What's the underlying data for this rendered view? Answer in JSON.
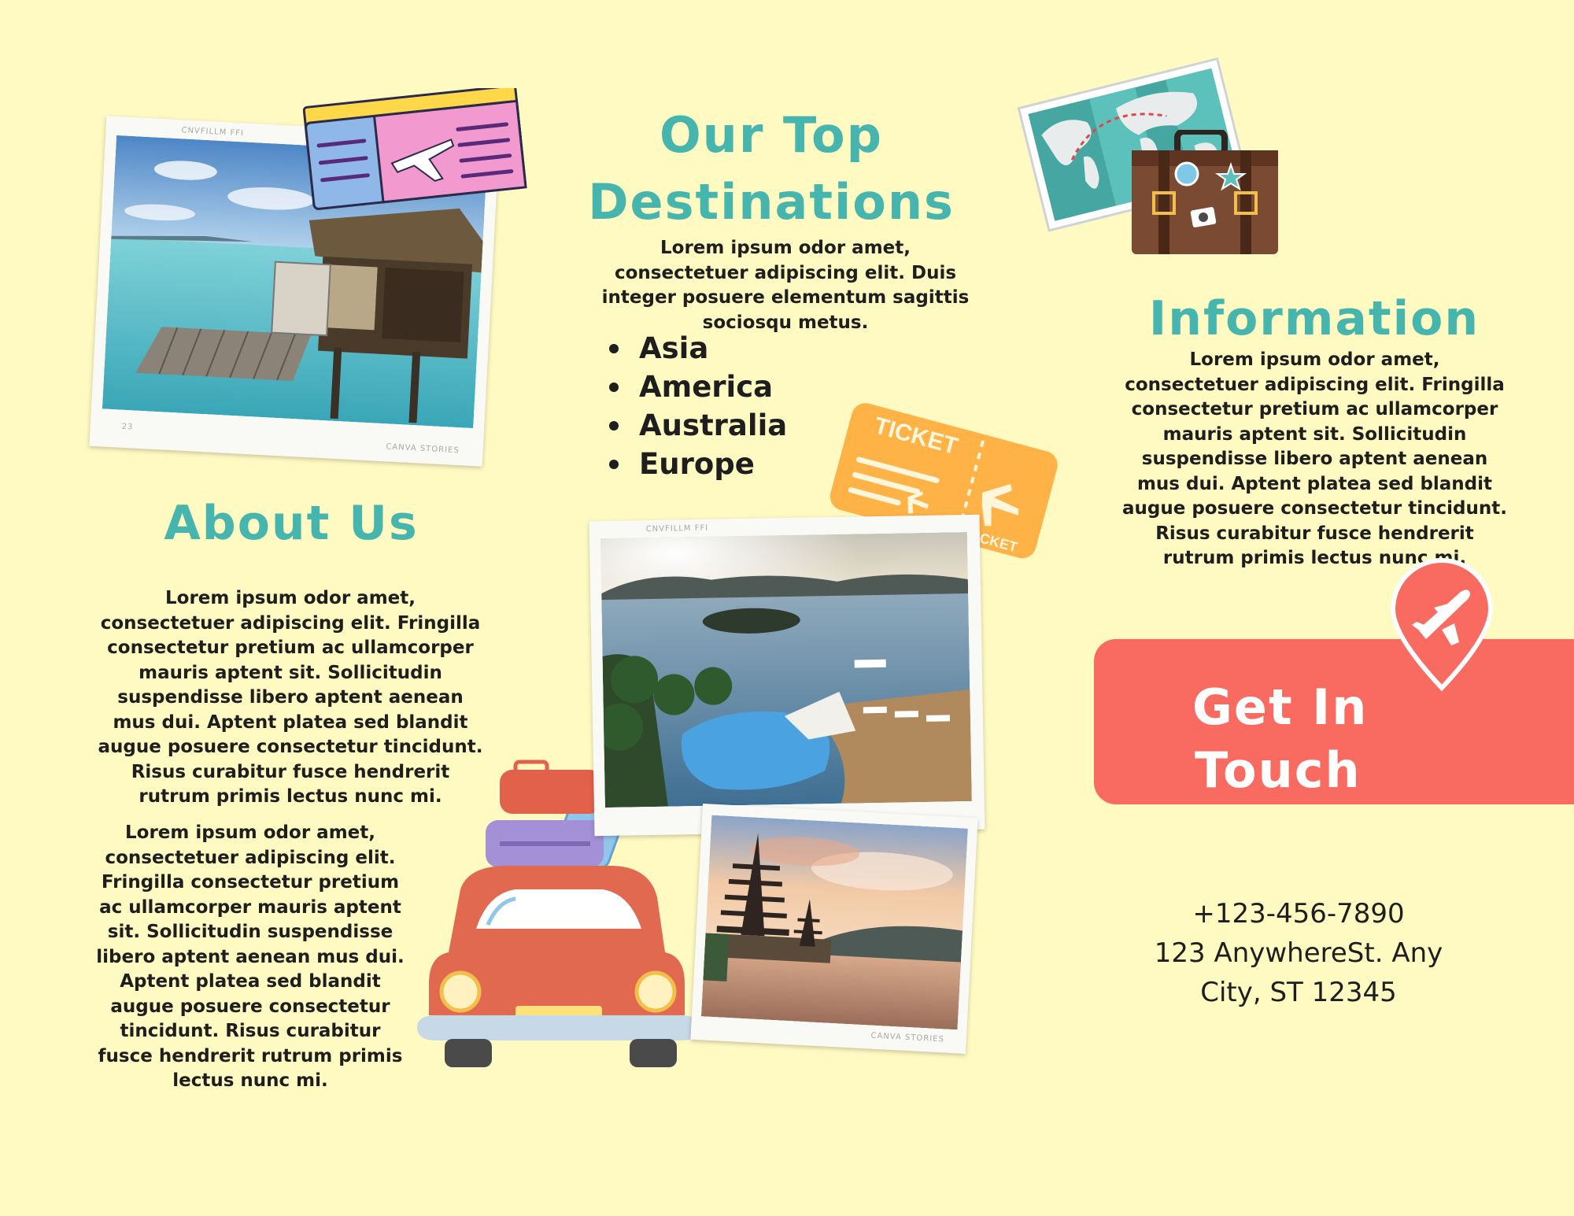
{
  "destinations": {
    "title_line1": "Our Top",
    "title_line2": "Destinations",
    "intro": "Lorem ipsum odor amet, consectetuer adipiscing elit. Duis integer posuere elementum sagittis sociosqu metus.",
    "items": [
      "Asia",
      "America",
      "Australia",
      "Europe"
    ]
  },
  "about": {
    "title": "About Us",
    "paragraph1": "Lorem ipsum odor amet, consectetuer adipiscing elit. Fringilla consectetur pretium ac ullamcorper mauris aptent sit. Sollicitudin suspendisse libero aptent aenean mus dui. Aptent platea sed blandit augue posuere consectetur tincidunt. Risus curabitur fusce hendrerit rutrum primis lectus nunc mi.",
    "paragraph2": "Lorem ipsum odor amet, consectetuer adipiscing elit. Fringilla consectetur pretium ac ullamcorper mauris aptent sit. Sollicitudin suspendisse libero aptent aenean mus dui. Aptent platea sed blandit augue posuere consectetur tincidunt. Risus curabitur fusce hendrerit rutrum primis lectus nunc mi."
  },
  "information": {
    "title": "Information",
    "paragraph": "Lorem ipsum odor amet, consectetuer adipiscing elit. Fringilla consectetur pretium ac ullamcorper mauris aptent sit. Sollicitudin suspendisse libero aptent aenean mus dui. Aptent platea sed blandit augue posuere consectetur tincidunt. Risus curabitur fusce hendrerit rutrum primis lectus nunc mi."
  },
  "contact": {
    "banner_line1": "Get In",
    "banner_line2": "Touch",
    "phone": "+123-456-7890",
    "address_line1": "123 AnywhereSt. Any",
    "address_line2": "City, ST 12345"
  },
  "photo_captions": {
    "film_brand": "CNVFILLM FFI",
    "stories": "CANVA STORIES",
    "frame_number": "23"
  },
  "ticket": {
    "label": "TICKET"
  },
  "icons": {
    "plane_pin": "plane-pin-icon",
    "ticket": "ticket-icon",
    "boarding_pass": "boarding-pass-icon",
    "world_map": "world-map-icon",
    "suitcase": "suitcase-icon",
    "car": "car-with-luggage-icon"
  },
  "colors": {
    "background": "#fff9c2",
    "heading_teal": "#45b5ad",
    "banner_coral": "#f96b60",
    "ticket_orange": "#ffb347",
    "text_dark": "#1e1e1e"
  }
}
